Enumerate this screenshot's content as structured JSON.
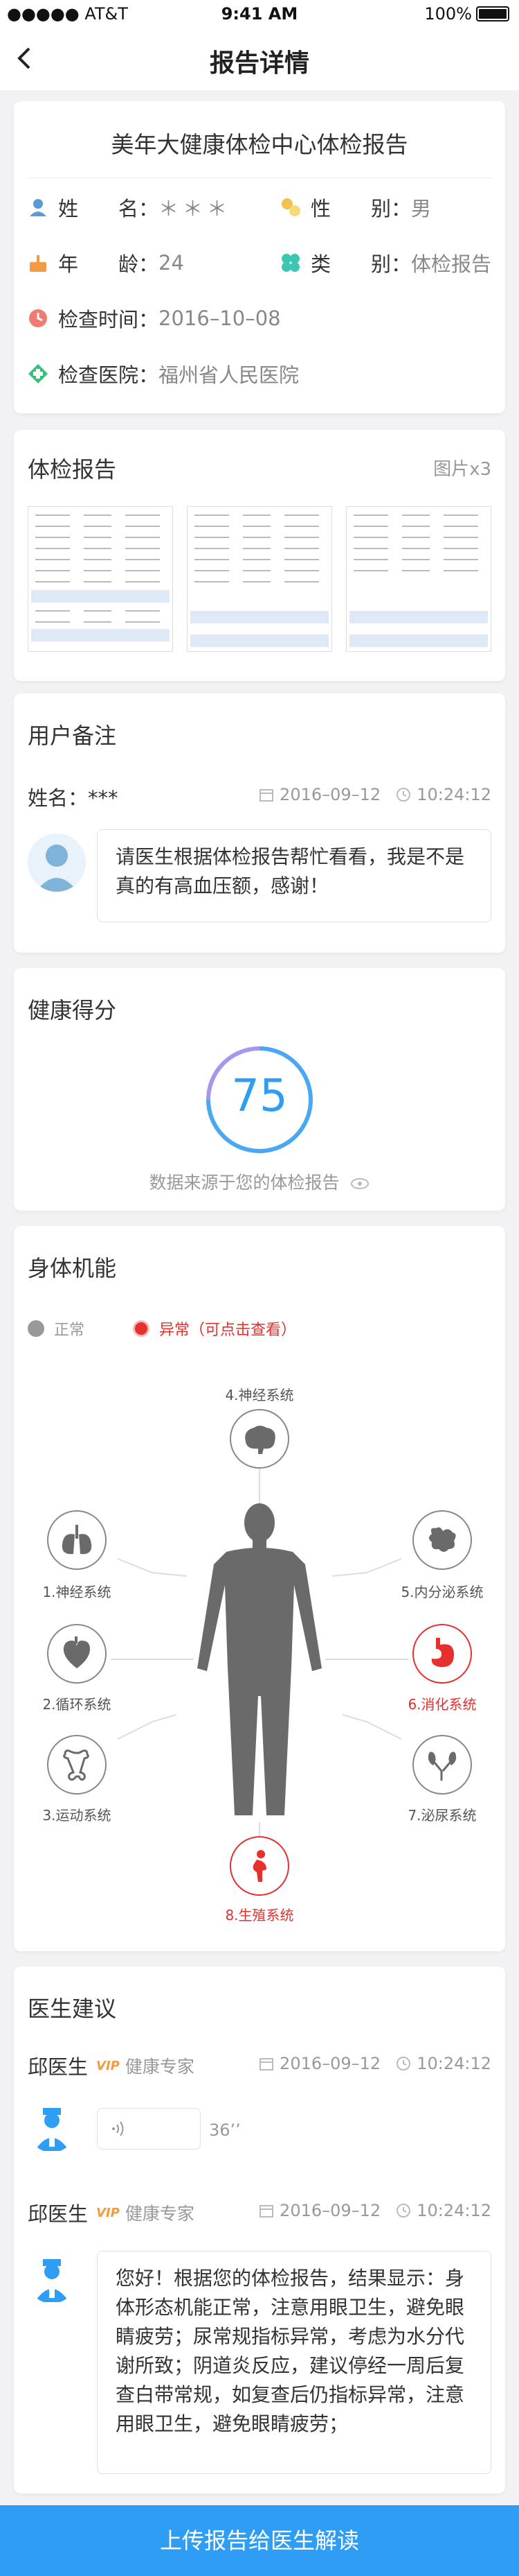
{
  "status": {
    "carrier": "●●●●● AT&T",
    "time": "9:41 AM",
    "battery": "100%"
  },
  "nav": {
    "title": "报告详情"
  },
  "report": {
    "title": "美年大健康体检中心体检报告",
    "name_label": "姓　　名：",
    "name_value": "＊＊＊",
    "gender_label": "性　　别：",
    "gender_value": "男",
    "age_label": "年　　龄：",
    "age_value": "24",
    "type_label": "类　　别：",
    "type_value": "体检报告",
    "time_label": "检查时间：",
    "time_value": "2016–10–08",
    "hospital_label": "检查医院：",
    "hospital_value": "福州省人民医院"
  },
  "exam": {
    "title": "体检报告",
    "count": "图片x3"
  },
  "note": {
    "title": "用户备注",
    "name": "姓名：***",
    "date": "2016–09–12",
    "time": "10:24:12",
    "message": "请医生根据体检报告帮忙看看，我是不是真的有高血压额，感谢！"
  },
  "health": {
    "title": "健康得分",
    "score": "75",
    "source": "数据来源于您的体检报告"
  },
  "body": {
    "title": "身体机能",
    "legend_normal": "正常",
    "legend_abnormal": "异常（可点击查看）",
    "systems": {
      "top": "4.神经系统",
      "l1": "1.神经系统",
      "l2": "2.循环系统",
      "l3": "3.运动系统",
      "r1": "5.内分泌系统",
      "r2": "6.消化系统",
      "r3": "7.泌尿系统",
      "bottom": "8.生殖系统"
    },
    "colors": {
      "normal": "#888888",
      "abnormal": "#e5302e"
    }
  },
  "advice": {
    "title": "医生建议",
    "items": [
      {
        "doctor": "邱医生",
        "vip": "VIP",
        "role": "健康专家",
        "date": "2016–09–12",
        "time": "10:24:12",
        "voice": "36’’"
      },
      {
        "doctor": "邱医生",
        "vip": "VIP",
        "role": "健康专家",
        "date": "2016–09–12",
        "time": "10:24:12",
        "message": "您好！根据您的体检报告，结果显示：身体形态机能正常，注意用眼卫生，避免眼睛疲劳；尿常规指标异常，考虑为水分代谢所致；阴道炎反应，建议停经一周后复查白带常规，如复查后仍指标异常，注意用眼卫生，避免眼睛疲劳；"
      }
    ]
  },
  "upload_button": "上传报告给医生解读",
  "accent": "#2d9ef3"
}
